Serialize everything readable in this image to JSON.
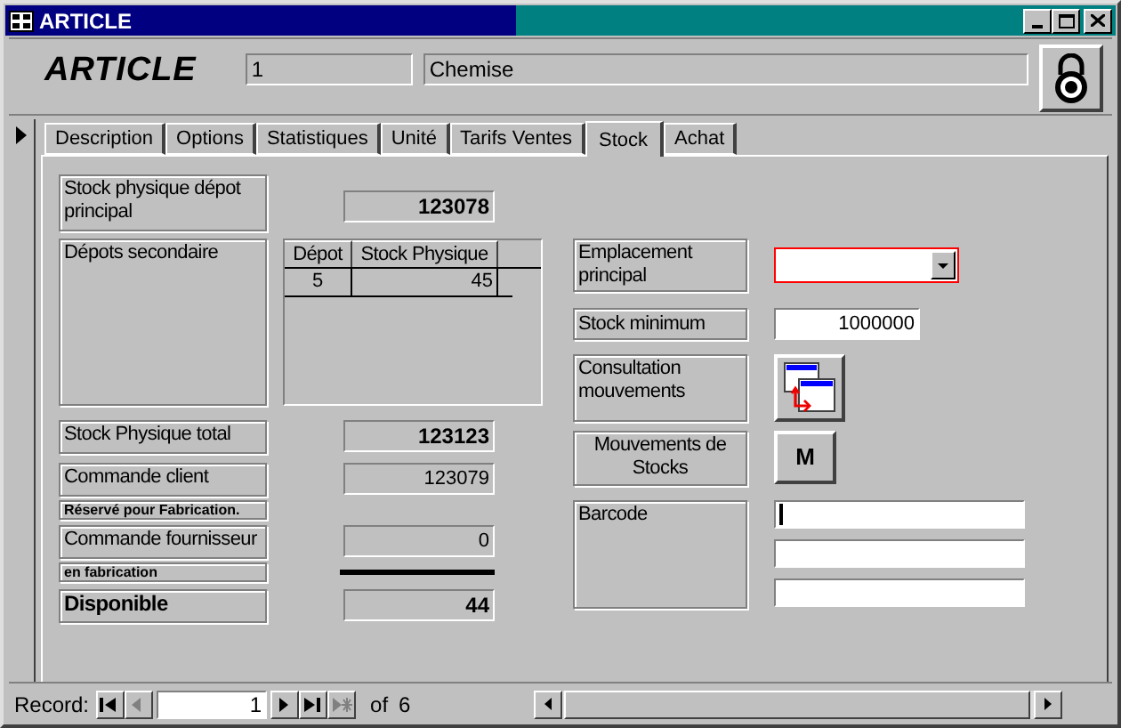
{
  "window": {
    "title": "ARTICLE"
  },
  "header": {
    "heading": "ARTICLE",
    "code": "1",
    "name": "Chemise"
  },
  "tabs": [
    {
      "label": "Description",
      "selected": false
    },
    {
      "label": "Options",
      "selected": false
    },
    {
      "label": "Statistiques",
      "selected": false
    },
    {
      "label": "Unité",
      "selected": false
    },
    {
      "label": "Tarifs Ventes",
      "selected": false
    },
    {
      "label": "Stock",
      "selected": true
    },
    {
      "label": "Achat",
      "selected": false
    }
  ],
  "left": [
    {
      "kind": "value",
      "label": "Stock physique dépot principal",
      "value": "123078",
      "bold": true
    },
    {
      "kind": "subform",
      "label": "Dépots secondaire",
      "columns": [
        "Dépot",
        "Stock Physique"
      ],
      "rows": [
        [
          "5",
          "45"
        ]
      ]
    },
    {
      "kind": "value",
      "label": "Stock Physique total",
      "value": "123123",
      "bold": true
    },
    {
      "kind": "value",
      "label": "Commande client",
      "value": "123079",
      "bold": false
    },
    {
      "kind": "note",
      "label": "Réservé pour Fabrication."
    },
    {
      "kind": "value",
      "label": "Commande fournisseur",
      "value": "0",
      "bold": false
    },
    {
      "kind": "note",
      "label": "en fabrication",
      "rule": true
    },
    {
      "kind": "value",
      "label": "Disponible",
      "value": "44",
      "bold": true,
      "label_bold": true
    }
  ],
  "right": [
    {
      "kind": "combo",
      "label": "Emplacement principal"
    },
    {
      "kind": "input",
      "label": "Stock minimum",
      "value": "1000000"
    },
    {
      "kind": "icon_button",
      "label": "Consultation mouvements"
    },
    {
      "kind": "text_button",
      "label": "Mouvements de Stocks",
      "button": "M"
    },
    {
      "kind": "multi_input",
      "label": "Barcode",
      "fields": [
        {
          "caret": true
        },
        {
          "caret": false
        },
        {
          "caret": false
        }
      ]
    }
  ],
  "record_nav": {
    "label": "Record:",
    "current": "1",
    "of": "of",
    "total": "6",
    "buttons": [
      {
        "kind": "first",
        "disabled": false
      },
      {
        "kind": "prev",
        "disabled": true
      },
      {
        "kind": "next",
        "disabled": false
      },
      {
        "kind": "last",
        "disabled": false
      },
      {
        "kind": "new",
        "disabled": true
      }
    ]
  }
}
